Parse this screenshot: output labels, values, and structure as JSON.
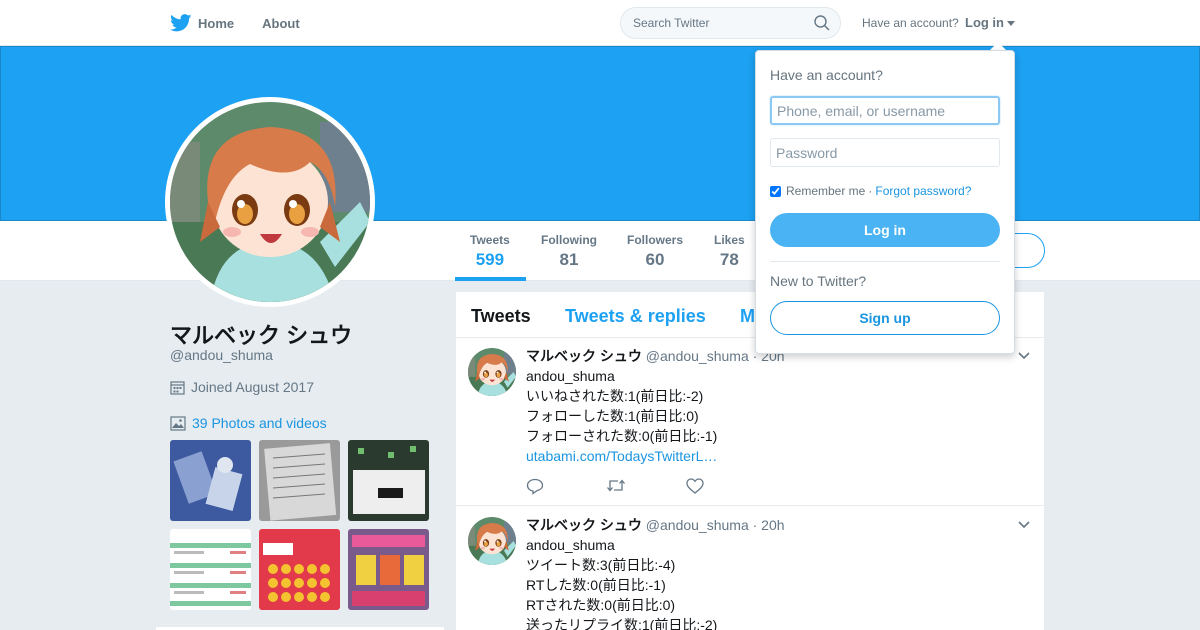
{
  "nav": {
    "home_label": "Home",
    "about_label": "About",
    "search_placeholder": "Search Twitter",
    "account_prompt": "Have an account?",
    "login_label": "Log in"
  },
  "profile": {
    "name": "マルベック シュウ",
    "handle": "@andou_shuma",
    "joined": "Joined August 2017",
    "photos_label": "39 Photos and videos"
  },
  "stats": [
    {
      "label": "Tweets",
      "value": "599",
      "active": true
    },
    {
      "label": "Following",
      "value": "81",
      "active": false
    },
    {
      "label": "Followers",
      "value": "60",
      "active": false
    },
    {
      "label": "Likes",
      "value": "78",
      "active": false
    }
  ],
  "timeline": {
    "tabs": [
      "Tweets",
      "Tweets & replies",
      "M"
    ],
    "tweets": [
      {
        "name": "マルベック シュウ",
        "handle": "@andou_shuma",
        "time": "· 20h",
        "lines": [
          "andou_shuma",
          "いいねされた数:1(前日比:-2)",
          "フォローした数:1(前日比:0)",
          "フォローされた数:0(前日比:-1)"
        ],
        "link": "utabami.com/TodaysTwitterL…"
      },
      {
        "name": "マルベック シュウ",
        "handle": "@andou_shuma",
        "time": "· 20h",
        "lines": [
          "andou_shuma",
          "ツイート数:3(前日比:-4)",
          "RTした数:0(前日比:-1)",
          "RTされた数:0(前日比:0)",
          "送ったリプライ数:1(前日比:-2)"
        ]
      }
    ]
  },
  "login_dropdown": {
    "title": "Have an account?",
    "username_placeholder": "Phone, email, or username",
    "password_placeholder": "Password",
    "remember_label": "Remember me",
    "separator": "·",
    "forgot_label": "Forgot password?",
    "login_button": "Log in",
    "new_prompt": "New to Twitter?",
    "signup_button": "Sign up"
  },
  "colors": {
    "brand": "#1da1f2",
    "link": "#1b95e0",
    "muted": "#657786",
    "login_button": "#4ab3f4"
  },
  "icons": [
    "twitter-bird-icon",
    "search-icon",
    "calendar-icon",
    "image-icon",
    "reply-icon",
    "retweet-icon",
    "like-icon",
    "chevron-down-icon"
  ]
}
